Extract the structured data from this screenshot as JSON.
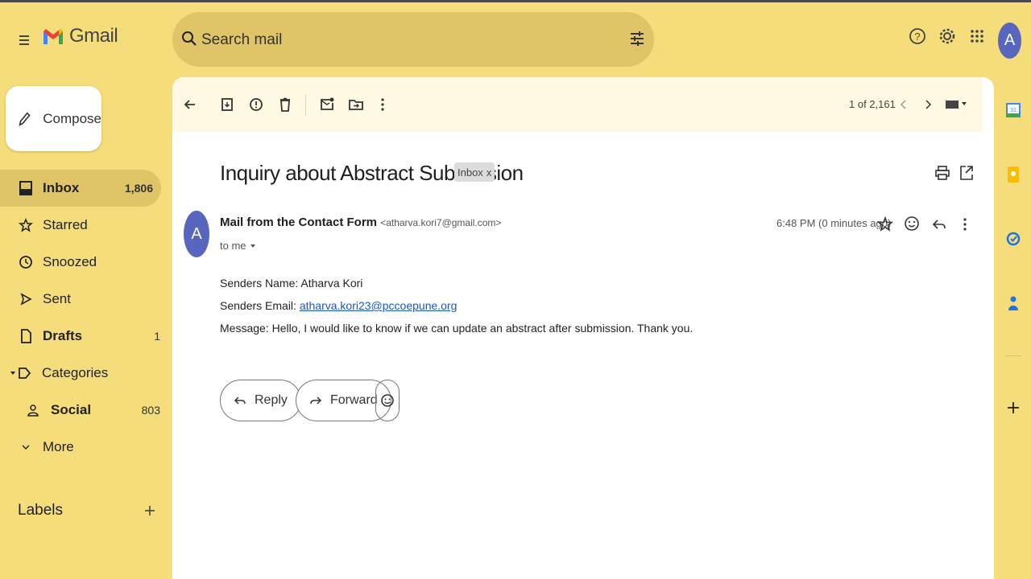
{
  "header": {
    "app_name": "Gmail",
    "search_placeholder": "Search mail",
    "avatar_letter": "A"
  },
  "sidebar": {
    "compose_label": "Compose",
    "items": [
      {
        "label": "Inbox",
        "count": "1,806"
      },
      {
        "label": "Starred",
        "count": ""
      },
      {
        "label": "Snoozed",
        "count": ""
      },
      {
        "label": "Sent",
        "count": ""
      },
      {
        "label": "Drafts",
        "count": "1"
      },
      {
        "label": "Categories",
        "count": ""
      },
      {
        "label": "Social",
        "count": "803"
      },
      {
        "label": "More",
        "count": ""
      }
    ],
    "labels_heading": "Labels"
  },
  "toolbar": {
    "paging": "1 of 2,161"
  },
  "email": {
    "subject": "Inquiry about Abstract Submission",
    "label_badge": "Inbox",
    "badge_close": "x",
    "sender_avatar_letter": "A",
    "sender_name": "Mail from the Contact Form",
    "sender_email": "<atharva.kori7@gmail.com>",
    "to_line": "to me",
    "time": "6:48 PM (0 minutes ago)",
    "body": {
      "name_line": "Senders Name: Atharva Kori",
      "email_prefix": "Senders Email: ",
      "email_link": "atharva.kori23@pccoepune.org",
      "message_line": "Message: Hello, I would like to know if we can update an abstract after submission. Thank you."
    },
    "reply_label": "Reply",
    "forward_label": "Forward"
  },
  "colors": {
    "background": "#f6dd7b",
    "search_bg": "#dfc468",
    "avatar": "#5866c0",
    "link": "#1a56c9"
  }
}
